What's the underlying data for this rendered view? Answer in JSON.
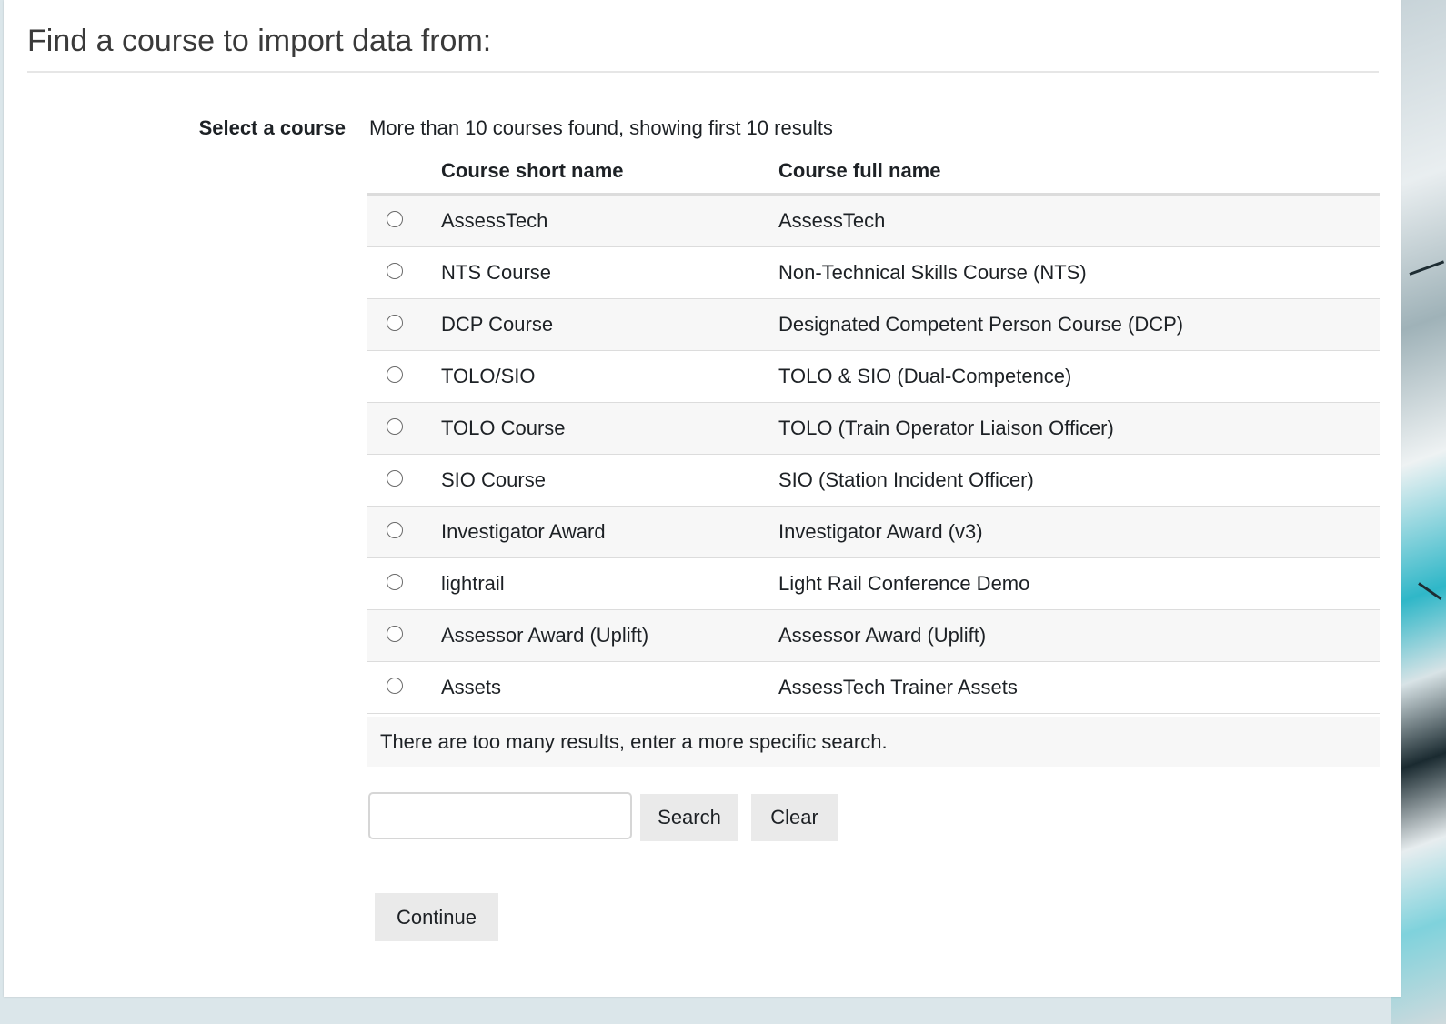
{
  "page": {
    "title": "Find a course to import data from:"
  },
  "form": {
    "select_label": "Select a course",
    "results_info": "More than 10 courses found, showing first 10 results",
    "columns": [
      "Course short name",
      "Course full name"
    ],
    "courses": [
      {
        "short": "AssessTech",
        "full": "AssessTech"
      },
      {
        "short": "NTS Course",
        "full": "Non-Technical Skills Course (NTS)"
      },
      {
        "short": "DCP Course",
        "full": "Designated Competent Person Course (DCP)"
      },
      {
        "short": "TOLO/SIO",
        "full": "TOLO & SIO (Dual-Competence)"
      },
      {
        "short": "TOLO Course",
        "full": "TOLO (Train Operator Liaison Officer)"
      },
      {
        "short": "SIO Course",
        "full": "SIO (Station Incident Officer)"
      },
      {
        "short": "Investigator Award",
        "full": "Investigator Award (v3)"
      },
      {
        "short": "lightrail",
        "full": "Light Rail Conference Demo"
      },
      {
        "short": "Assessor Award (Uplift)",
        "full": "Assessor Award (Uplift)"
      },
      {
        "short": "Assets",
        "full": "AssessTech Trainer Assets"
      }
    ],
    "too_many_message": "There are too many results, enter a more specific search.",
    "search": {
      "value": "",
      "search_label": "Search",
      "clear_label": "Clear"
    },
    "continue_label": "Continue"
  },
  "colors": {
    "panel_bg": "#ffffff",
    "row_stripe": "#f7f7f7",
    "button_bg": "#eaeaea",
    "text": "#1d2125"
  }
}
